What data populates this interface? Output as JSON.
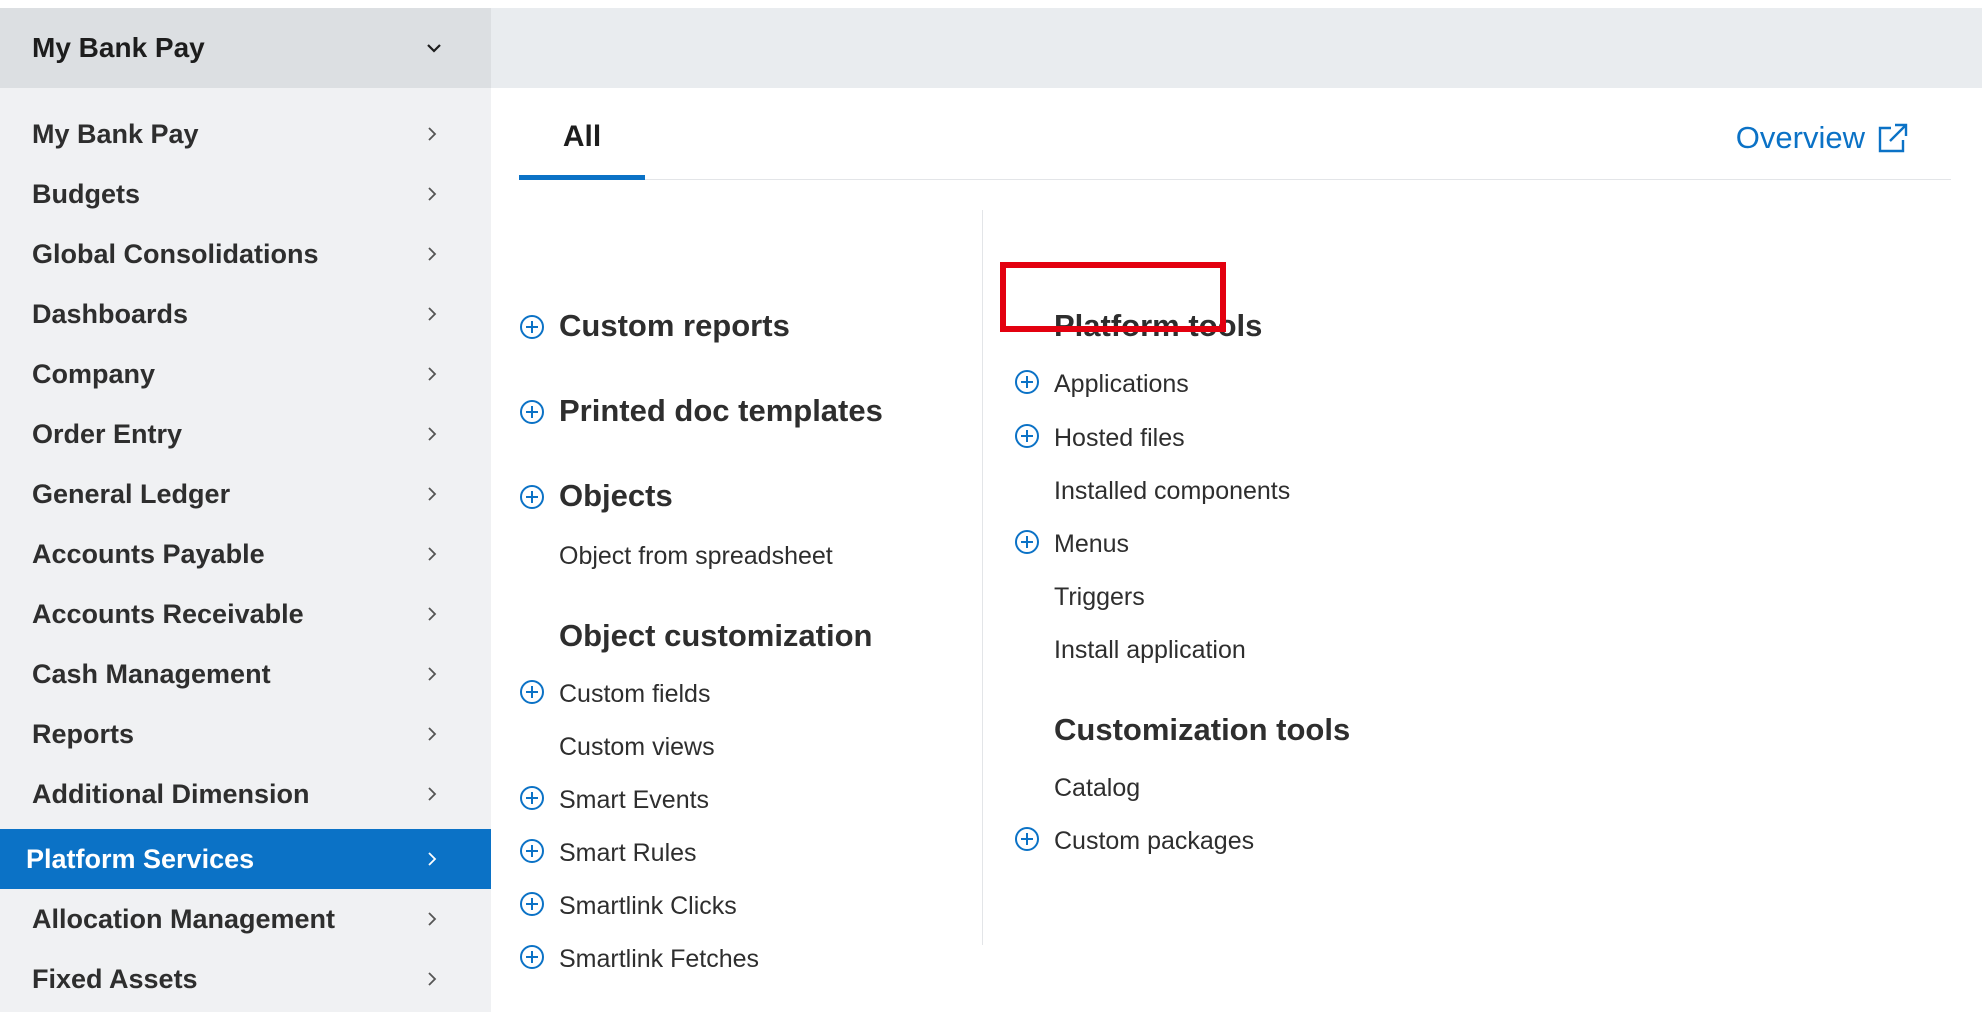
{
  "app_switcher": {
    "title": "My Bank Pay"
  },
  "sidebar": {
    "items": [
      {
        "label": "My Bank Pay"
      },
      {
        "label": "Budgets"
      },
      {
        "label": "Global Consolidations"
      },
      {
        "label": "Dashboards"
      },
      {
        "label": "Company"
      },
      {
        "label": "Order Entry"
      },
      {
        "label": "General Ledger"
      },
      {
        "label": "Accounts Payable"
      },
      {
        "label": "Accounts Receivable"
      },
      {
        "label": "Cash Management"
      },
      {
        "label": "Reports"
      },
      {
        "label": "Additional Dimension"
      },
      {
        "label": "Platform Services",
        "active": true
      },
      {
        "label": "Allocation Management"
      },
      {
        "label": "Fixed Assets"
      }
    ]
  },
  "tabs": {
    "all": "All",
    "overview": "Overview"
  },
  "left_column": {
    "custom_reports": "Custom reports",
    "printed_doc_templates": "Printed doc templates",
    "objects": "Objects",
    "object_from_spreadsheet": "Object from spreadsheet",
    "object_customization": "Object customization",
    "custom_fields": "Custom fields",
    "custom_views": "Custom views",
    "smart_events": "Smart Events",
    "smart_rules": "Smart Rules",
    "smartlink_clicks": "Smartlink Clicks",
    "smartlink_fetches": "Smartlink Fetches"
  },
  "right_column": {
    "platform_tools": "Platform tools",
    "applications": "Applications",
    "hosted_files": "Hosted files",
    "installed_components": "Installed components",
    "menus": "Menus",
    "triggers": "Triggers",
    "install_application": "Install application",
    "customization_tools": "Customization tools",
    "catalog": "Catalog",
    "custom_packages": "Custom packages"
  },
  "colors": {
    "accent": "#0b72c6",
    "highlight": "#e3000f"
  }
}
